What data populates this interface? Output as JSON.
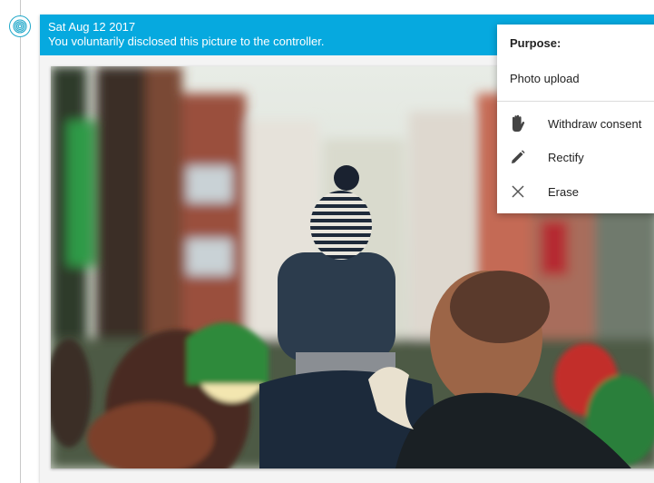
{
  "timeline": {
    "node_icon": "fingerprint-icon",
    "accent": "#1ea7c9"
  },
  "card": {
    "date": "Sat Aug 12 2017",
    "description": "You voluntarily disclosed this picture to the controller.",
    "header_color": "#06a9df"
  },
  "menu": {
    "title": "Purpose:",
    "purpose_value": "Photo upload",
    "items": [
      {
        "label": "Withdraw consent",
        "icon": "hand-icon"
      },
      {
        "label": "Rectify",
        "icon": "pencil-icon"
      },
      {
        "label": "Erase",
        "icon": "close-icon"
      }
    ]
  }
}
